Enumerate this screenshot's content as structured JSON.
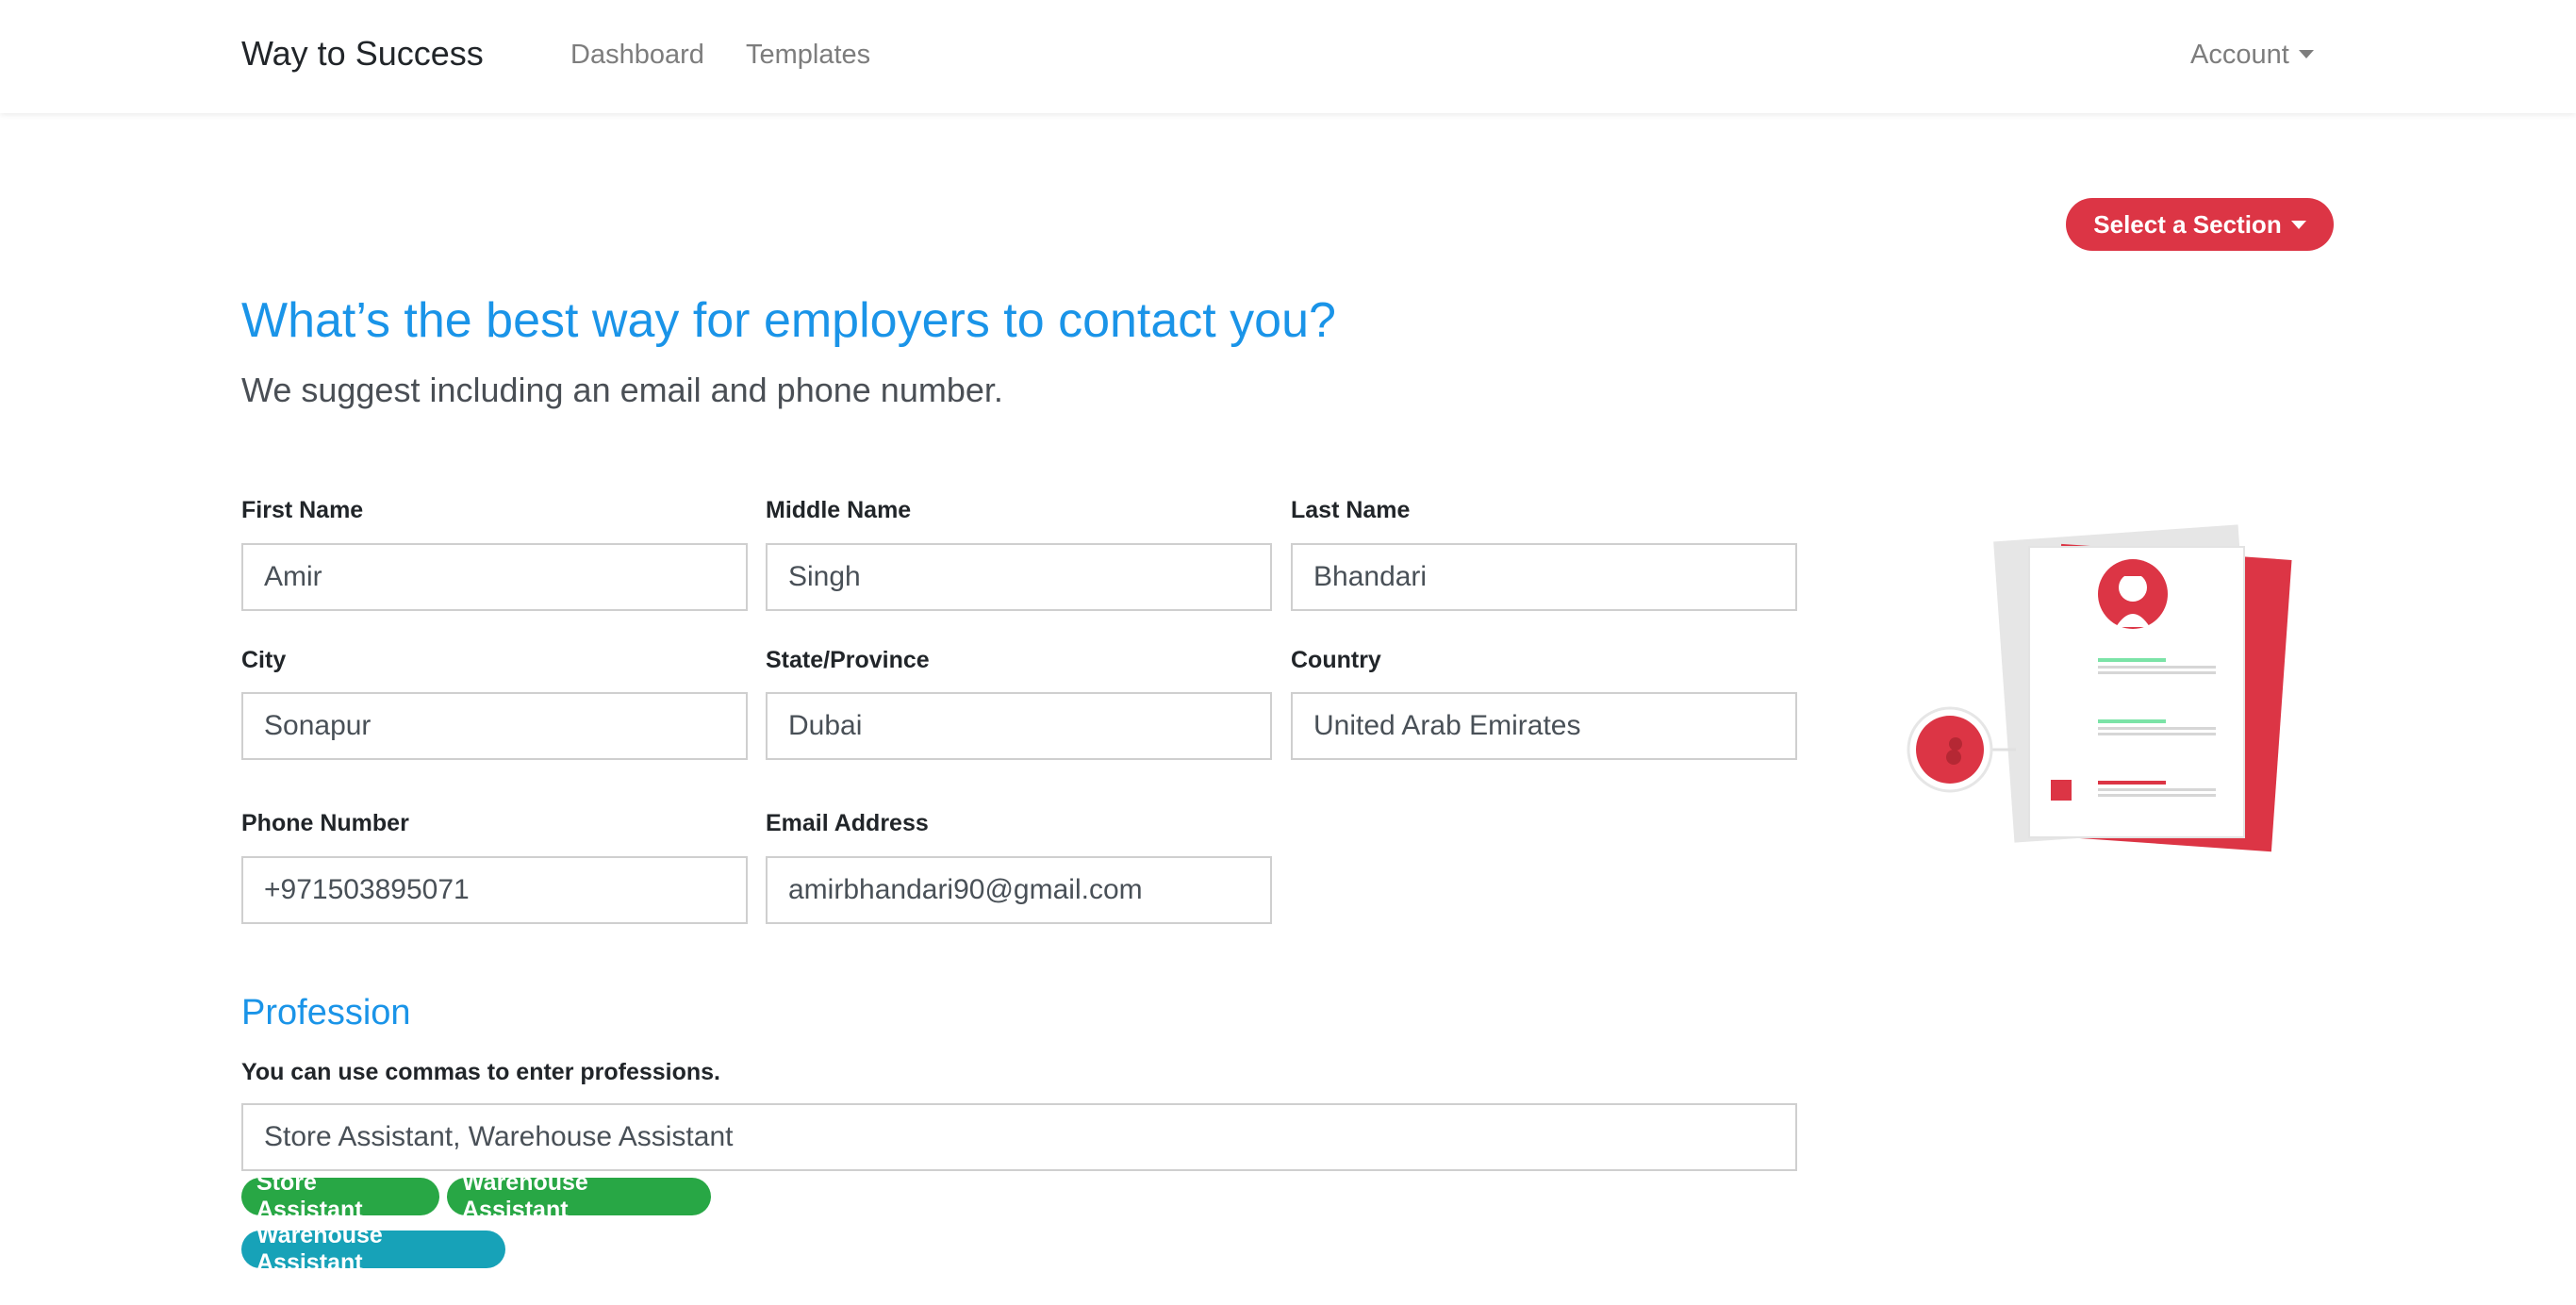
{
  "navbar": {
    "brand": "Way to Success",
    "links": [
      "Dashboard",
      "Templates"
    ],
    "account": "Account"
  },
  "section_button": "Select a Section",
  "heading": "What’s the best way for employers to contact you?",
  "subheading": "We suggest including an email and phone number.",
  "form": {
    "first_name": {
      "label": "First Name",
      "value": "Amir"
    },
    "middle_name": {
      "label": "Middle Name",
      "value": "Singh"
    },
    "last_name": {
      "label": "Last Name",
      "value": "Bhandari"
    },
    "city": {
      "label": "City",
      "value": "Sonapur"
    },
    "state": {
      "label": "State/Province",
      "value": "Dubai"
    },
    "country": {
      "label": "Country",
      "value": "United Arab Emirates"
    },
    "phone": {
      "label": "Phone Number",
      "value": "+971503895071"
    },
    "email": {
      "label": "Email Address",
      "value": "amirbhandari90@gmail.com"
    }
  },
  "profession": {
    "title": "Profession",
    "hint": "You can use commas to enter professions.",
    "value": "Store Assistant, Warehouse Assistant",
    "tags_green": [
      "Store Assistant",
      "Warehouse Assistant"
    ],
    "tags_teal": [
      "Warehouse Assistant"
    ]
  },
  "colors": {
    "accent_blue": "#1a94e8",
    "danger_red": "#dc3545",
    "success_green": "#28a745",
    "info_teal": "#17a2b8"
  }
}
